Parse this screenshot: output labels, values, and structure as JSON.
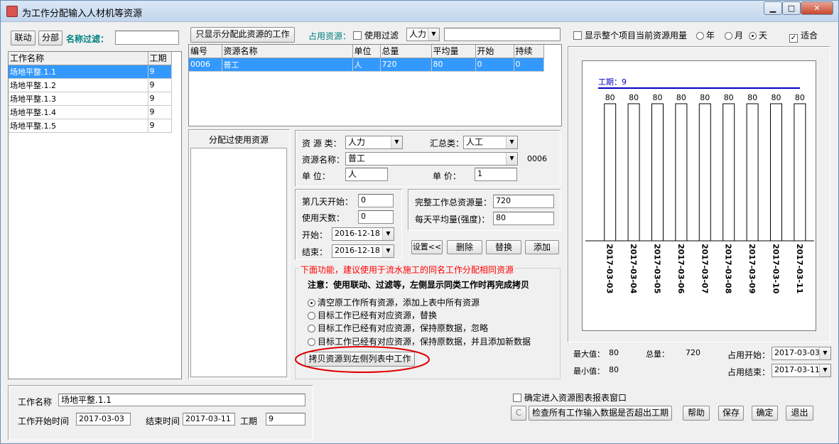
{
  "window": {
    "title": "为工作分配输入人材机等资源",
    "min": "▁",
    "max": "□",
    "close": "✕"
  },
  "left_panel": {
    "link_btn": "联动",
    "split_btn": "分部",
    "filter_label": "名称过滤：",
    "filter_value": "",
    "columns": [
      "工作名称",
      "工期"
    ],
    "rows": [
      {
        "name": "场地平整.1.1",
        "days": "9"
      },
      {
        "name": "场地平整.1.2",
        "days": "9"
      },
      {
        "name": "场地平整.1.3",
        "days": "9"
      },
      {
        "name": "场地平整.1.4",
        "days": "9"
      },
      {
        "name": "场地平整.1.5",
        "days": "9"
      }
    ]
  },
  "top": {
    "only_show_btn": "只显示分配此资源的工作",
    "occupy_label": "占用资源：",
    "use_filter_label": "使用过滤",
    "type_select": "人力",
    "filter_text": "",
    "columns": [
      "编号",
      "资源名称",
      "单位",
      "总量",
      "平均量",
      "开始",
      "持续"
    ],
    "rows": [
      {
        "code": "0006",
        "name": "普工",
        "unit": "人",
        "total": "720",
        "avg": "80",
        "start": "0",
        "dur": "0"
      }
    ]
  },
  "assigned": {
    "header": "分配过使用资源"
  },
  "form": {
    "res_class_label": "资 源 类：",
    "res_class": "人力",
    "summary_label": "汇总类：",
    "summary": "人工",
    "res_name_label": "资源名称：",
    "res_name": "普工",
    "res_code": "0006",
    "unit_label": "单    位：",
    "unit": "人",
    "price_label": "单    价：",
    "price": "1",
    "day_start_label": "第几天开始：",
    "day_start": "0",
    "use_days_label": "使用天数：",
    "use_days": "0",
    "start_label": "开始：",
    "start": "2016-12-18",
    "end_label": "结束：",
    "end": "2016-12-18",
    "total_label": "完整工作总资源量：",
    "total": "720",
    "daily_label": "每天平均量(强度)：",
    "daily": "80",
    "btn_set": "设置<<",
    "btn_delete": "删除",
    "btn_replace": "替换",
    "btn_add": "添加"
  },
  "copy": {
    "legend": "下面功能，建议使用于流水施工的同名工作分配相同资源",
    "note": "注意：使用联动、过滤等，左侧显示同类工作时再完成拷贝",
    "options": [
      "清空原工作所有资源，添加上表中所有资源",
      "目标工作已经有对应资源，替换",
      "目标工作已经有对应资源，保持原数据，忽略",
      "目标工作已经有对应资源，保持原数据，并且添加新数据"
    ],
    "copy_btn": "拷贝资源到左侧列表中工作"
  },
  "right": {
    "show_all_label": "显示整个项目当前资源用量",
    "year": "年",
    "month": "月",
    "day": "天",
    "fit": "适合",
    "stats": {
      "max_label": "最大值：",
      "max": "80",
      "min_label": "最小值：",
      "min": "80",
      "total_label": "总量：",
      "total": "720",
      "occ_start_label": "占用开始：",
      "occ_start": "2017-03-03",
      "occ_end_label": "占用结束：",
      "occ_end": "2017-03-11"
    }
  },
  "chart_data": {
    "type": "bar",
    "title": "工期：9",
    "categories": [
      "2017-03-03",
      "2017-03-04",
      "2017-03-05",
      "2017-03-06",
      "2017-03-07",
      "2017-03-08",
      "2017-03-09",
      "2017-03-10",
      "2017-03-11"
    ],
    "values": [
      80,
      80,
      80,
      80,
      80,
      80,
      80,
      80,
      80
    ],
    "ylim": [
      0,
      80
    ],
    "grid": false
  },
  "bottom": {
    "work_name_label": "工作名称",
    "work_name": "场地平整.1.1",
    "start_label": "工作开始时间",
    "start": "2017-03-03",
    "end_label": "结束时间",
    "end": "2017-03-11",
    "dur_label": "工期",
    "dur": "9",
    "chart_window_label": "确定进入资源图表报表窗口",
    "c_btn": "C",
    "check_btn": "检查所有工作输入数据是否超出工期",
    "help": "帮助",
    "save": "保存",
    "ok": "确定",
    "exit": "退出"
  },
  "colors": {
    "accent": "#3399ff",
    "label_teal": "#008080",
    "legend_red": "#ff0000",
    "chart_line": "#0000c0"
  }
}
